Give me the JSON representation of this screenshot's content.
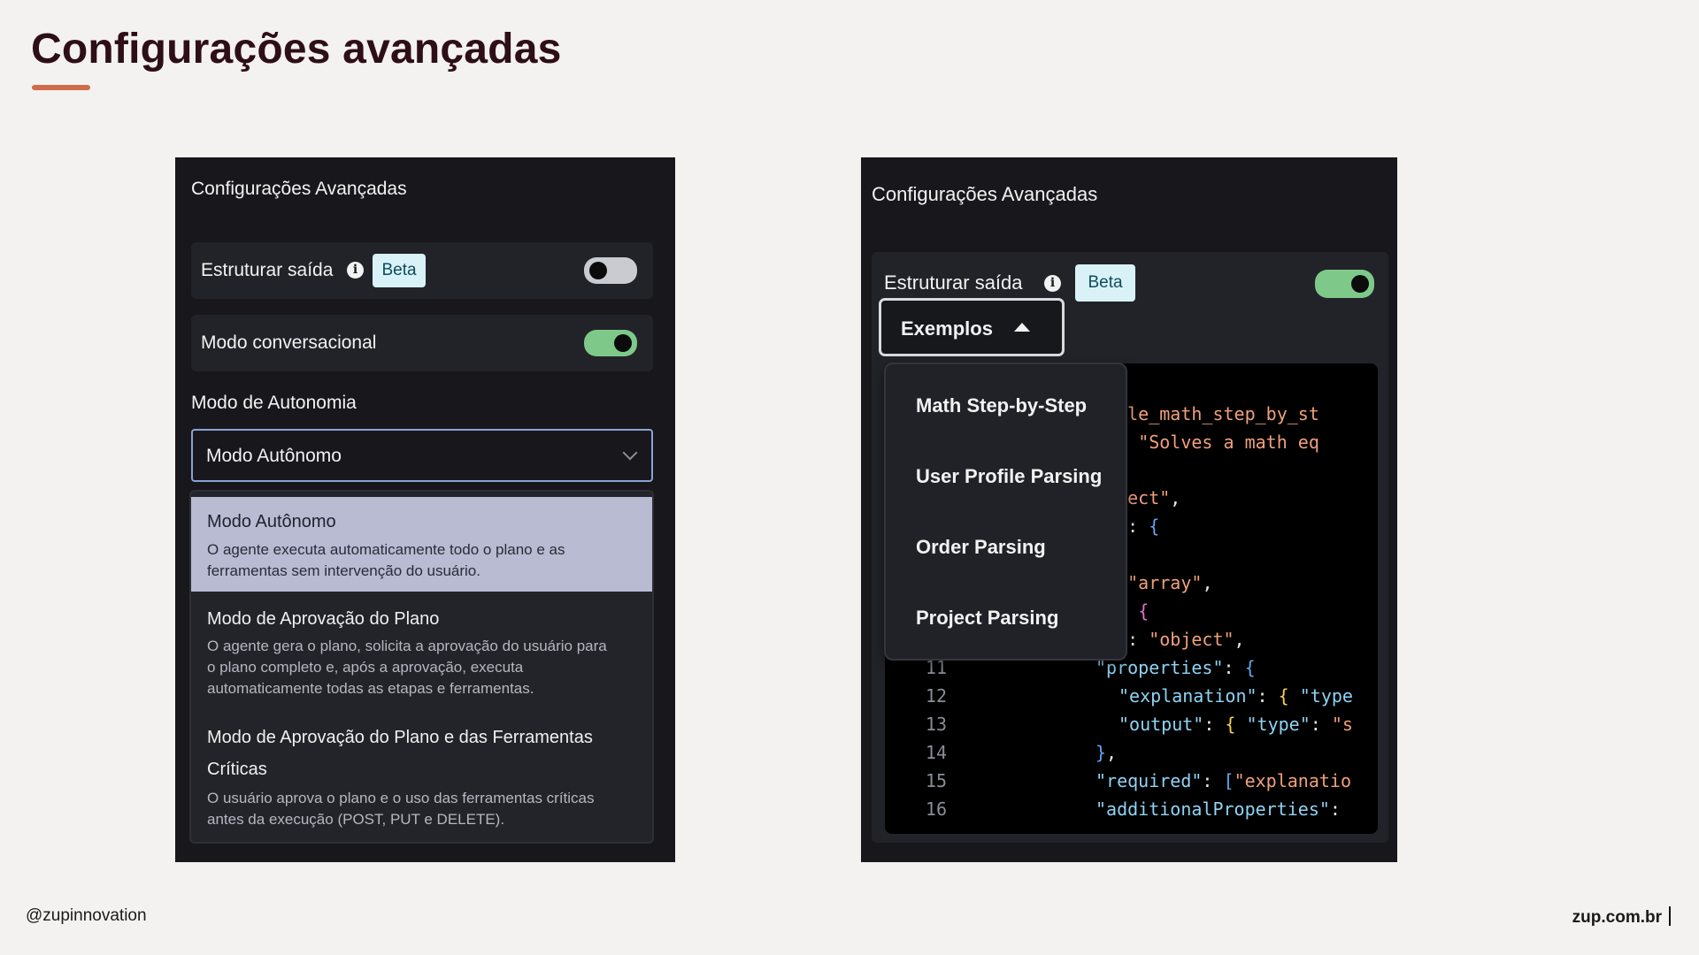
{
  "slide": {
    "title": "Configurações avançadas",
    "footer_left": "@zupinnovation",
    "footer_right": "zup.com.br"
  },
  "left_panel": {
    "title": "Configurações Avançadas",
    "structure_output": {
      "label": "Estruturar saída",
      "badge": "Beta",
      "enabled": false
    },
    "conversational": {
      "label": "Modo conversacional",
      "enabled": true
    },
    "autonomy": {
      "label": "Modo de Autonomia",
      "selected": "Modo Autônomo",
      "options": [
        {
          "title": "Modo Autônomo",
          "desc1": "O agente executa automaticamente todo o plano e as",
          "desc2": "ferramentas sem intervenção do usuário.",
          "desc3": ""
        },
        {
          "title": "Modo de Aprovação do Plano",
          "desc1": "O agente gera o plano, solicita a aprovação do usuário para",
          "desc2": "o plano completo e, após a aprovação, executa",
          "desc3": "automaticamente todas as etapas e ferramentas."
        },
        {
          "title": "Modo de Aprovação do Plano e das Ferramentas",
          "title2": "Críticas",
          "desc1": "O usuário aprova o plano e o uso das ferramentas críticas",
          "desc2": "antes da execução (POST, PUT e DELETE).",
          "desc3": ""
        }
      ]
    }
  },
  "right_panel": {
    "title": "Configurações Avançadas",
    "structure_output": {
      "label": "Estruturar saída",
      "badge": "Beta",
      "enabled": true
    },
    "examples_button": "Exemplos",
    "examples_menu": [
      "Math Step-by-Step",
      "User Profile Parsing",
      "Order Parsing",
      "Project Parsing"
    ],
    "code_lines": [
      {
        "n": "",
        "text": ""
      },
      {
        "n": "",
        "frag": "ample_math_step_by_st"
      },
      {
        "n": "",
        "frag": "n\": \"Solves a math eq"
      },
      {
        "n": "",
        "frag": ""
      },
      {
        "n": "",
        "frag": "object\","
      },
      {
        "n": "",
        "frag": "es\": {"
      },
      {
        "n": "",
        "frag": ": {"
      },
      {
        "n": "",
        "frag": "\": \"array\","
      },
      {
        "n": "",
        "frag": "s\": {"
      },
      {
        "n": "",
        "frag": "pe\": \"object\","
      },
      {
        "n": "11",
        "frag": "\"properties\": {"
      },
      {
        "n": "12",
        "frag": "\"explanation\": { \"type"
      },
      {
        "n": "13",
        "frag": "\"output\": { \"type\": \"s"
      },
      {
        "n": "14",
        "frag": "},"
      },
      {
        "n": "15",
        "frag": "\"required\": [\"explanatio"
      },
      {
        "n": "16",
        "frag": "\"additionalProperties\":"
      }
    ]
  },
  "colors": {
    "accent_underline": "#cf6d4b",
    "toggle_on": "#7ec98a",
    "toggle_off": "#c9cbd1",
    "selected_option": "#b8bbd1"
  },
  "icons": [
    "info-icon",
    "chevron-down-icon",
    "caret-up-icon"
  ]
}
